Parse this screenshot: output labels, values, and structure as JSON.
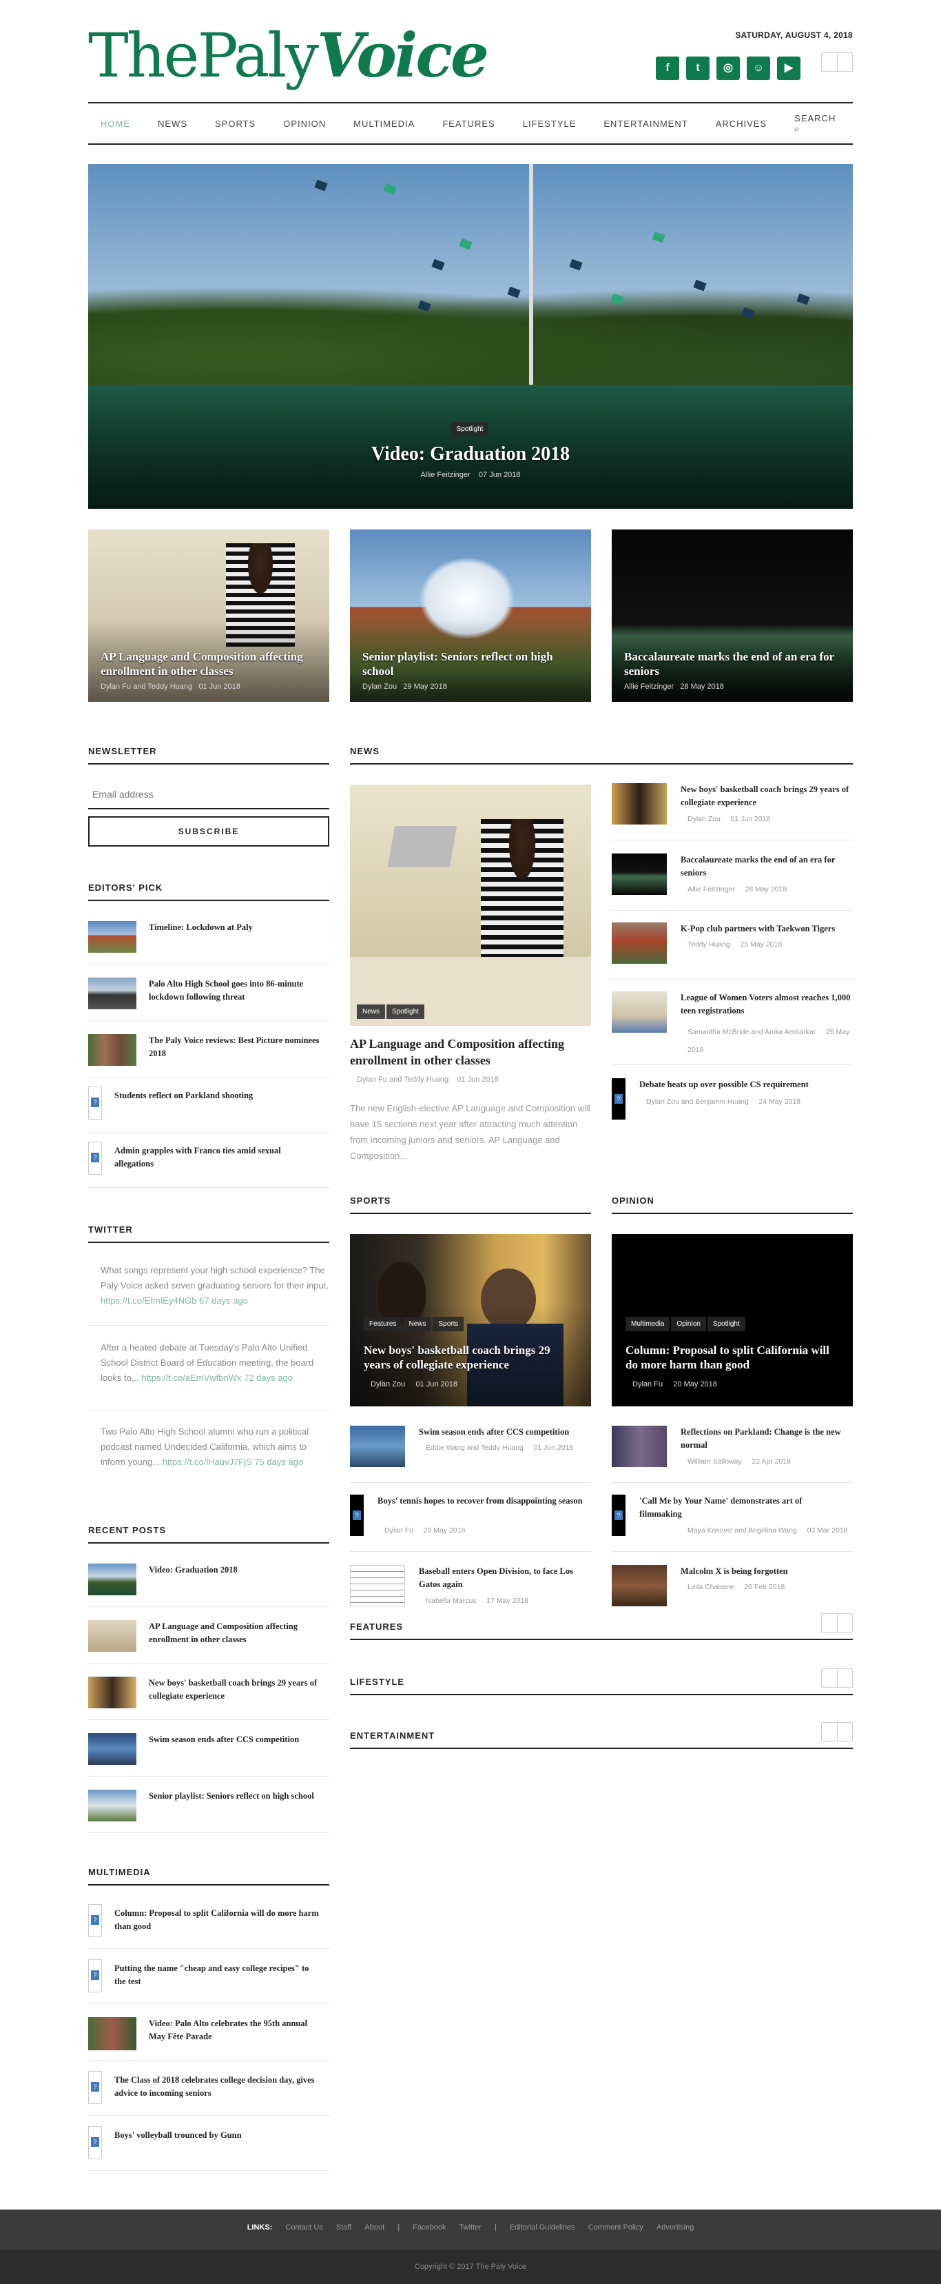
{
  "site": {
    "logo_part1": "ThePaly",
    "logo_part2": "Voice",
    "date": "SATURDAY, AUGUST 4, 2018"
  },
  "social": [
    {
      "icon": "facebook-icon",
      "glyph": "f"
    },
    {
      "icon": "twitter-icon",
      "glyph": "t"
    },
    {
      "icon": "instagram-icon",
      "glyph": "◎"
    },
    {
      "icon": "snapchat-icon",
      "glyph": "☺"
    },
    {
      "icon": "youtube-icon",
      "glyph": "▶"
    }
  ],
  "nav": [
    "HOME",
    "NEWS",
    "SPORTS",
    "OPINION",
    "MULTIMEDIA",
    "FEATURES",
    "LIFESTYLE",
    "ENTERTAINMENT",
    "ARCHIVES",
    "SEARCH"
  ],
  "hero": {
    "tag": "Spotlight",
    "title": "Video: Graduation 2018",
    "author": "Allie Feitzinger",
    "date": "07 Jun 2018"
  },
  "cards": [
    {
      "title": "AP Language and Composition affecting enrollment in other classes",
      "author": "Dylan Fu",
      "and": "and",
      "author2": "Teddy Huang",
      "date": "01 Jun 2018"
    },
    {
      "title": "Senior playlist: Seniors reflect on high school",
      "author": "Dylan Zou",
      "date": "29 May 2018"
    },
    {
      "title": "Baccalaureate marks the end of an era for seniors",
      "author": "Allie Feitzinger",
      "date": "28 May 2018"
    }
  ],
  "newsletter": {
    "title": "NEWSLETTER",
    "placeholder": "Email address",
    "button": "SUBSCRIBE"
  },
  "editors_pick": {
    "title": "EDITORS' PICK",
    "items": [
      "Timeline: Lockdown at Paly",
      "Palo Alto High School goes into 86-minute lockdown following threat",
      "The Paly Voice reviews: Best Picture nominees 2018",
      "Students reflect on Parkland shooting",
      "Admin grapples with Franco ties amid sexual allegations"
    ]
  },
  "twitter": {
    "title": "TWITTER",
    "tweets": [
      {
        "text": "What songs represent your high school experience? The Paly Voice asked seven graduating seniors for their input.",
        "link": "https://t.co/EfmIEy4NGb",
        "age": "67 days ago"
      },
      {
        "text": "After a heated debate at Tuesday's Palo Alto Unified School District Board of Education meeting, the board looks to...",
        "link": "https://t.co/aEmVwfbnWx",
        "age": "72 days ago"
      },
      {
        "text": "Two Palo Alto High School alumni who run a political podcast named Undecided California, which aims to inform young...",
        "link": "https://t.co/lHauvJ7FjS",
        "age": "75 days ago"
      }
    ]
  },
  "recent_posts": {
    "title": "RECENT POSTS",
    "items": [
      "Video: Graduation 2018",
      "AP Language and Composition affecting enrollment in other classes",
      "New boys' basketball coach brings 29 years of collegiate experience",
      "Swim season ends after CCS competition",
      "Senior playlist: Seniors reflect on high school"
    ]
  },
  "multimedia": {
    "title": "MULTIMEDIA",
    "items": [
      "Column: Proposal to split California will do more harm than good",
      "Putting the name \"cheap and easy college recipes\" to the test",
      "Video: Palo Alto celebrates the 95th annual May Fête Parade",
      "The Class of 2018 celebrates college decision day, gives advice to incoming seniors",
      "Boys' volleyball trounced by Gunn"
    ]
  },
  "news": {
    "title": "NEWS",
    "main": {
      "tags": [
        "News",
        "Spotlight"
      ],
      "title": "AP Language and Composition affecting enrollment in other classes",
      "author": "Dylan Fu and Teddy Huang",
      "date": "01 Jun 2018",
      "excerpt": "The new English-elective AP Language and Composition will have 15 sections next year after attracting much attention from incoming juniors and seniors. AP Language and Composition..."
    },
    "list": [
      {
        "title": "New boys' basketball coach brings 29 years of collegiate experience",
        "author": "Dylan Zou",
        "date": "01 Jun 2018"
      },
      {
        "title": "Baccalaureate marks the end of an era for seniors",
        "author": "Allie Feitzinger",
        "date": "28 May 2018"
      },
      {
        "title": "K-Pop club partners with Taekwon Tigers",
        "author": "Teddy Huang",
        "date": "25 May 2018"
      },
      {
        "title": "League of Women Voters almost reaches 1,000 teen registrations",
        "author": "Samantha McBride and Anika Ambarkar",
        "date": "25 May 2018"
      },
      {
        "title": "Debate heats up over possible CS requirement",
        "author": "Dylan Zou and Benjamin Huang",
        "date": "24 May 2018"
      }
    ]
  },
  "sports": {
    "title": "SPORTS",
    "main": {
      "tags": [
        "Features",
        "News",
        "Sports"
      ],
      "title": "New boys' basketball coach brings 29 years of collegiate experience",
      "author": "Dylan Zou",
      "date": "01 Jun 2018"
    },
    "list": [
      {
        "title": "Swim season ends after CCS competition",
        "author": "Eddie Wang and Teddy Huang",
        "date": "01 Jun 2018"
      },
      {
        "title": "Boys' tennis hopes to recover from disappointing season",
        "author": "Dylan Fu",
        "date": "20 May 2018"
      },
      {
        "title": "Baseball enters Open Division, to face Los Gatos again",
        "author": "Isabella Marcus",
        "date": "17 May 2018"
      }
    ]
  },
  "opinion": {
    "title": "OPINION",
    "main": {
      "tags": [
        "Multimedia",
        "Opinion",
        "Spotlight"
      ],
      "title": "Column: Proposal to split California will do more harm than good",
      "author": "Dylan Fu",
      "date": "20 May 2018"
    },
    "list": [
      {
        "title": "Reflections on Parkland: Change is the new normal",
        "author": "William Salloway",
        "date": "22 Apr 2018"
      },
      {
        "title": "'Call Me by Your Name' demonstrates art of filmmaking",
        "author": "Maya Kosovic and Angelina Wang",
        "date": "03 Mar 2018"
      },
      {
        "title": "Malcolm X is being forgotten",
        "author": "Leila Chabane",
        "date": "26 Feb 2018"
      }
    ]
  },
  "more_sections": [
    "FEATURES",
    "LIFESTYLE",
    "ENTERTAINMENT"
  ],
  "footer": {
    "links_label": "LINKS:",
    "links": [
      "Contact Us",
      "Staff",
      "About",
      "|",
      "Facebook",
      "Twitter",
      "|",
      "Editorial Guidelines",
      "Comment Policy",
      "Advertising"
    ],
    "copyright": "Copyright © 2017 The Paly Voice"
  }
}
